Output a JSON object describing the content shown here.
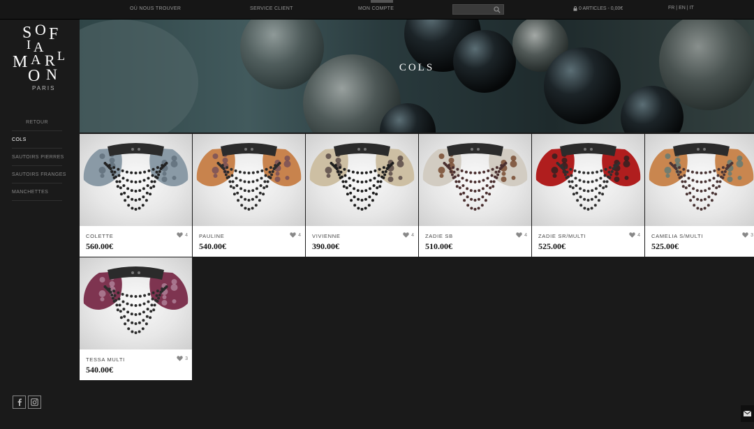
{
  "topbar": {
    "where_label": "OÙ NOUS TROUVER",
    "service_label": "SERVICE CLIENT",
    "account_label": "MON COMPTE",
    "search_placeholder": "",
    "cart_label": "0 ARTICLES - 0,00€",
    "lang_fr": "FR",
    "lang_en": "EN",
    "lang_it": "IT",
    "lang_sep": " | "
  },
  "sidebar": {
    "logo_text": "SOFIA MARLON",
    "logo_sub": "PARIS",
    "back_label": "RETOUR",
    "items": [
      {
        "label": "COLS",
        "active": true
      },
      {
        "label": "SAUTOIRS PIERRES",
        "active": false
      },
      {
        "label": "SAUTOIRS FRANGES",
        "active": false
      },
      {
        "label": "MANCHETTES",
        "active": false
      }
    ]
  },
  "hero": {
    "title": "COLS"
  },
  "products": [
    {
      "name": "COLETTE",
      "price": "560.00€",
      "likes": "4",
      "collar": "#8a9aa6",
      "pattern": "#5b6a76",
      "beads": "#222"
    },
    {
      "name": "PAULINE",
      "price": "540.00€",
      "likes": "4",
      "collar": "#c8834d",
      "pattern": "#6e4a5a",
      "beads": "#2a2a2a"
    },
    {
      "name": "VIVIENNE",
      "price": "390.00€",
      "likes": "4",
      "collar": "#cdbfa3",
      "pattern": "#4a3b3b",
      "beads": "#1d1d1d"
    },
    {
      "name": "ZADIE SB",
      "price": "510.00€",
      "likes": "4",
      "collar": "#d2ccc2",
      "pattern": "#6b3a1c",
      "beads": "#4a2f2f"
    },
    {
      "name": "ZADIE SR/MULTI",
      "price": "525.00€",
      "likes": "4",
      "collar": "#b01e1e",
      "pattern": "#222",
      "beads": "#2f2f2f"
    },
    {
      "name": "CAMELIA S/MULTI",
      "price": "525.00€",
      "likes": "3",
      "collar": "#c9864f",
      "pattern": "#557a7a",
      "beads": "#4a3535"
    },
    {
      "name": "TESSA MULTI",
      "price": "540.00€",
      "likes": "3",
      "collar": "#7e3450",
      "pattern": "#b58aa0",
      "beads": "#2b2b2b"
    }
  ],
  "colors": {
    "background": "#1a1a1a",
    "card": "#ffffff",
    "active_nav": "#ffffff"
  },
  "icons": {
    "search": "search-icon",
    "cart": "lock-icon",
    "like": "heart-icon",
    "facebook": "facebook-icon",
    "instagram": "instagram-icon",
    "mail": "mail-icon"
  }
}
